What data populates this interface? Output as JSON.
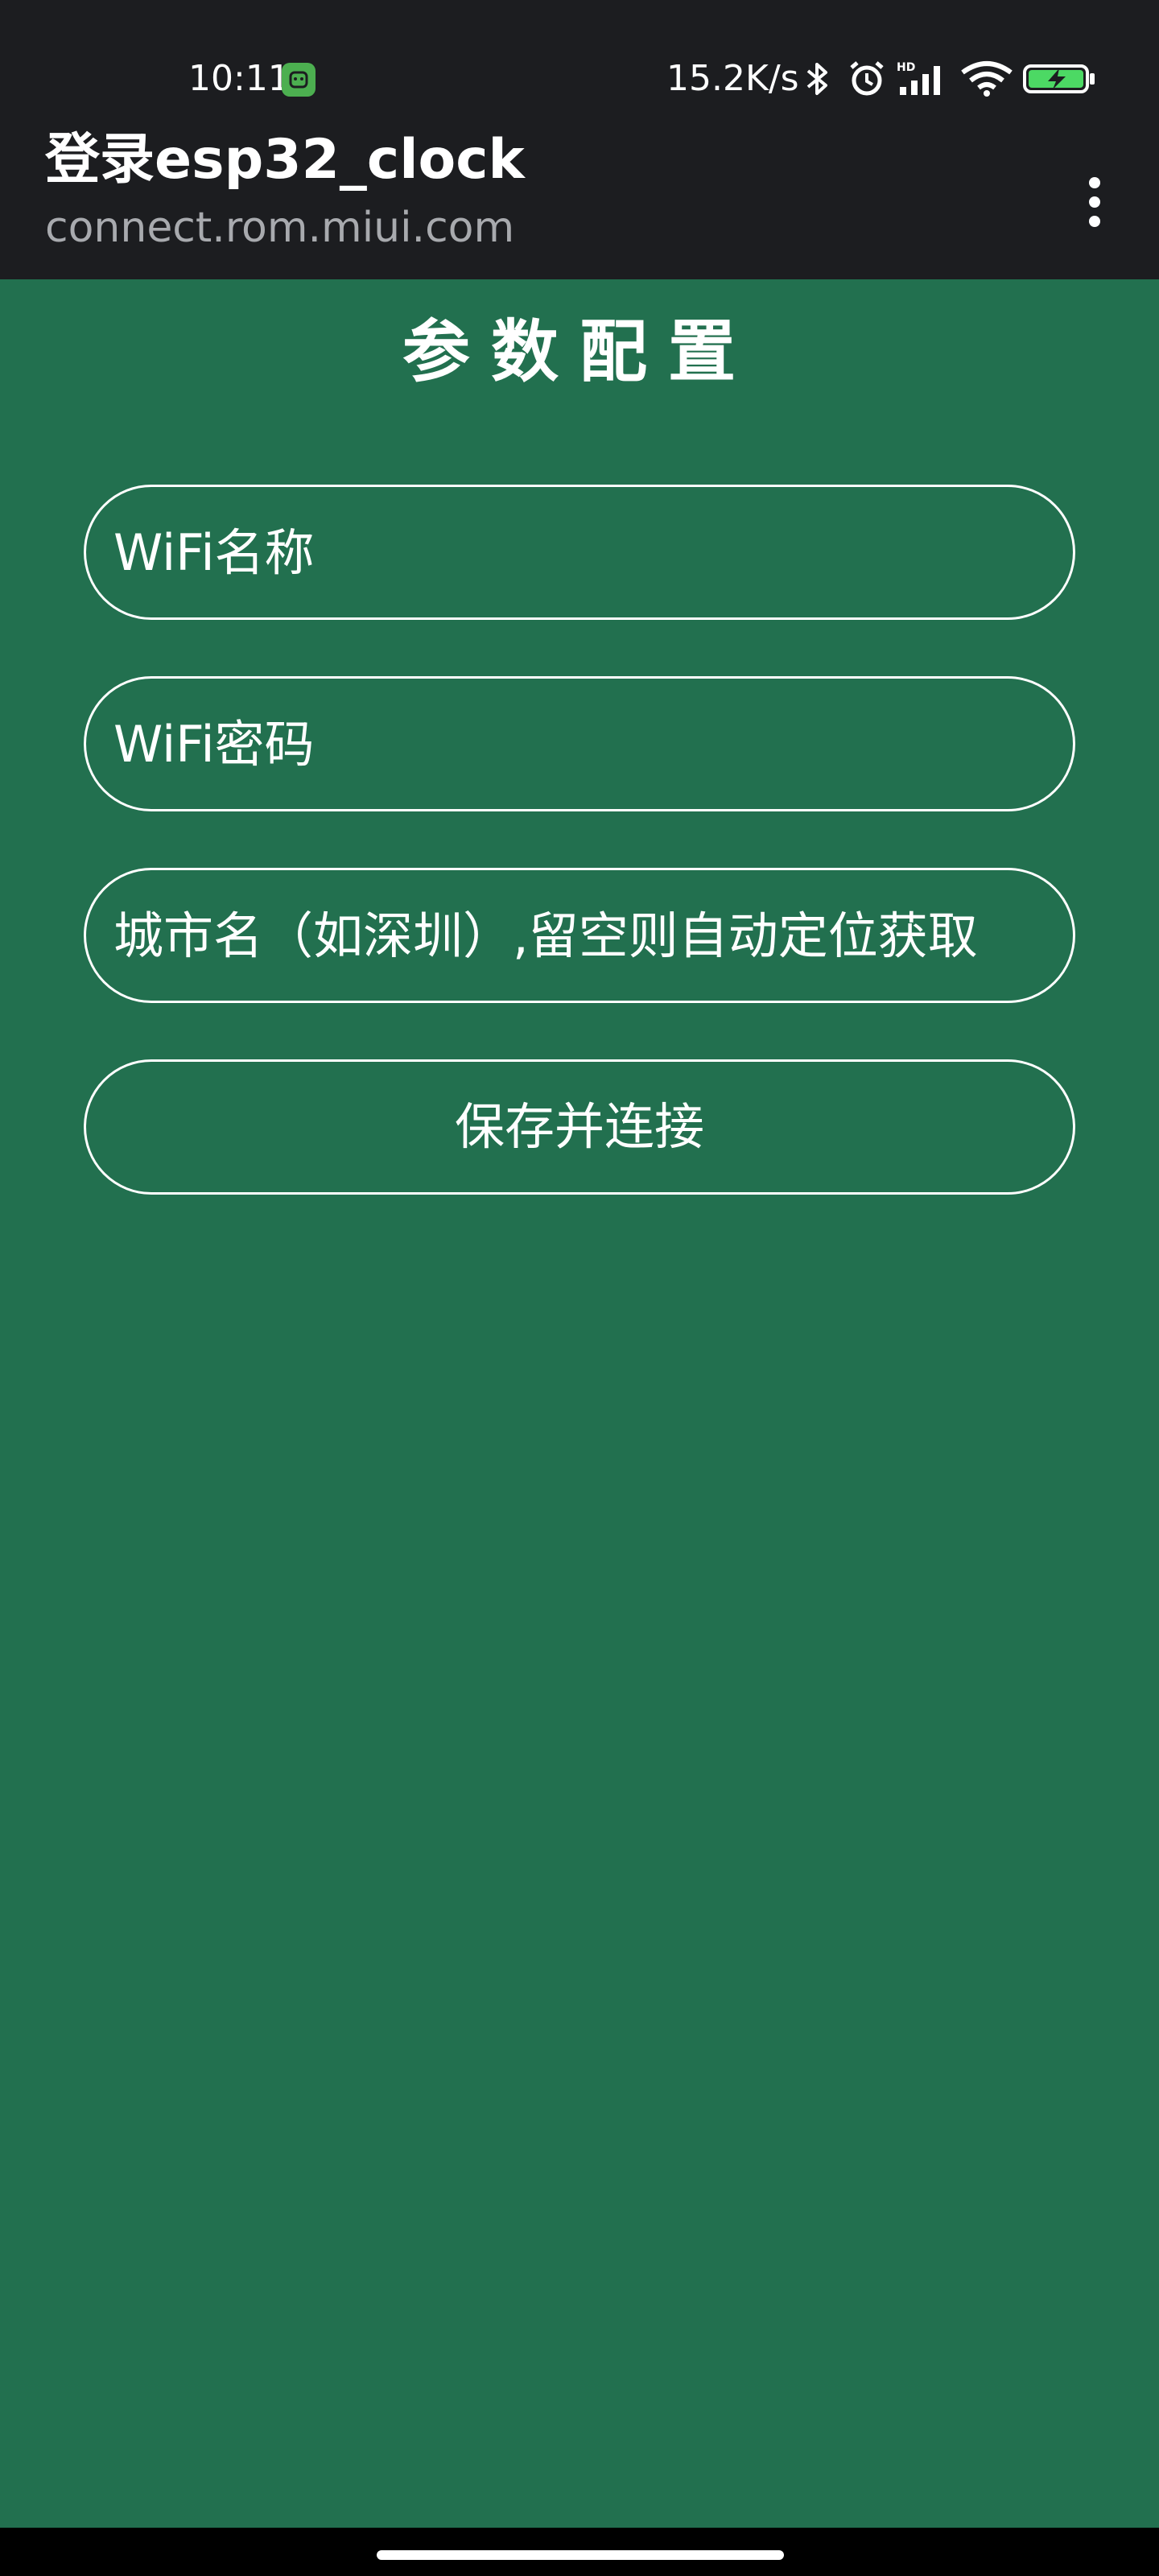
{
  "status_bar": {
    "time": "10:11",
    "network_speed": "15.2K/s",
    "icons": [
      "app-notification-icon",
      "bluetooth-icon",
      "alarm-icon",
      "hd-signal-icon",
      "wifi-icon",
      "battery-charging-icon"
    ]
  },
  "header": {
    "title": "登录esp32_clock",
    "url": "connect.rom.miui.com"
  },
  "form": {
    "title": "参数配置",
    "ssid_placeholder": "WiFi名称",
    "password_placeholder": "WiFi密码",
    "city_placeholder": "城市名（如深圳）,留空则自动定位获取",
    "submit_label": "保存并连接"
  },
  "colors": {
    "header_bg": "#1c1d20",
    "page_bg": "#22704f",
    "accent_battery": "#4cd964"
  }
}
